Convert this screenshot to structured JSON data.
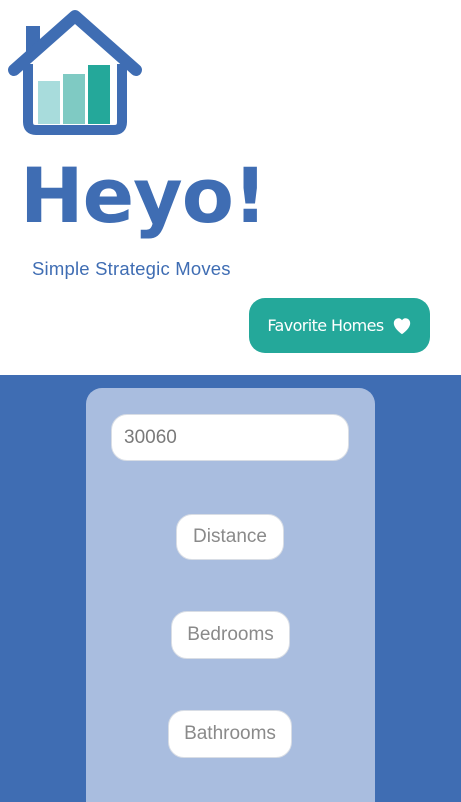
{
  "header": {
    "title": "Heyo!",
    "tagline": "Simple Strategic Moves",
    "favorites_label": "Favorite Homes",
    "logo_icon": "house-chart-logo-icon",
    "heart_icon": "heart-icon"
  },
  "search": {
    "zip_value": "30060",
    "filters": {
      "distance": "Distance",
      "bedrooms": "Bedrooms",
      "bathrooms": "Bathrooms"
    }
  },
  "colors": {
    "primary_blue": "#3f6db3",
    "panel_blue": "#a9bddf",
    "accent_teal": "#24a89a",
    "white": "#ffffff"
  }
}
